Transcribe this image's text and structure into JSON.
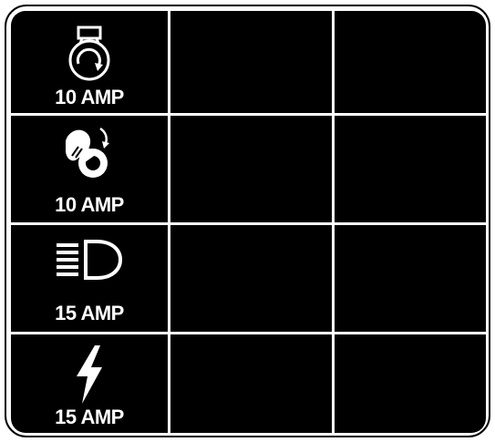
{
  "fuse_panel": {
    "rows": [
      {
        "icon": "engine-ignition-icon",
        "amp_label": "10 AMP"
      },
      {
        "icon": "ignition-key-icon",
        "amp_label": "10 AMP"
      },
      {
        "icon": "headlight-icon",
        "amp_label": "15 AMP"
      },
      {
        "icon": "lightning-bolt-icon",
        "amp_label": "15 AMP"
      }
    ],
    "colors": {
      "panel_background": "#000000",
      "lines": "#ffffff",
      "text": "#ffffff"
    }
  }
}
